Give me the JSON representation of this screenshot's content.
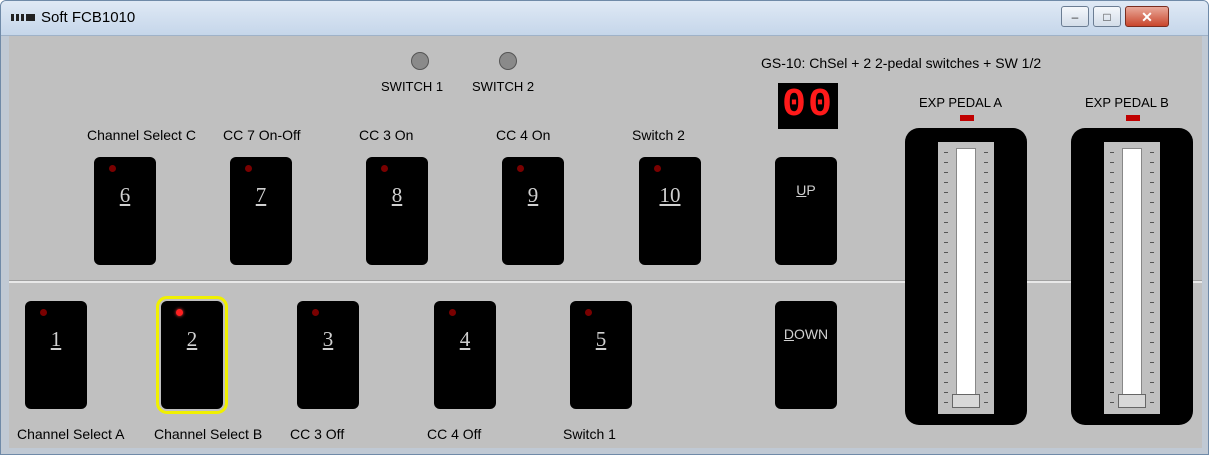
{
  "window": {
    "title": "Soft FCB1010",
    "minimize_label": "–",
    "maximize_label": "□",
    "close_label": "✕"
  },
  "switches": [
    {
      "label": "SWITCH 1"
    },
    {
      "label": "SWITCH 2"
    }
  ],
  "preset_description": "GS-10: ChSel + 2 2-pedal switches + SW 1/2",
  "display_value": "00",
  "upper_pedals": [
    {
      "number": "6",
      "label": "Channel Select C",
      "led_on": false
    },
    {
      "number": "7",
      "label": "CC 7 On-Off",
      "led_on": false
    },
    {
      "number": "8",
      "label": "CC 3 On",
      "led_on": false
    },
    {
      "number": "9",
      "label": "CC 4 On",
      "led_on": false
    },
    {
      "number": "10",
      "label": "Switch 2",
      "led_on": false
    }
  ],
  "lower_pedals": [
    {
      "number": "1",
      "label": "Channel Select A",
      "led_on": false,
      "selected": false
    },
    {
      "number": "2",
      "label": "Channel Select B",
      "led_on": true,
      "selected": true
    },
    {
      "number": "3",
      "label": "CC 3 Off",
      "led_on": false,
      "selected": false
    },
    {
      "number": "4",
      "label": "CC 4 Off",
      "led_on": false,
      "selected": false
    },
    {
      "number": "5",
      "label": "Switch 1",
      "led_on": false,
      "selected": false
    }
  ],
  "nav": {
    "up_label": "UP",
    "down_label": "DOWN"
  },
  "expression_pedals": [
    {
      "label": "EXP PEDAL A",
      "position": 0.0
    },
    {
      "label": "EXP PEDAL B",
      "position": 0.0
    }
  ],
  "colors": {
    "led_active": "#ff2020",
    "display_digits": "#ff1a1a",
    "selection_outline": "#f0f000"
  }
}
